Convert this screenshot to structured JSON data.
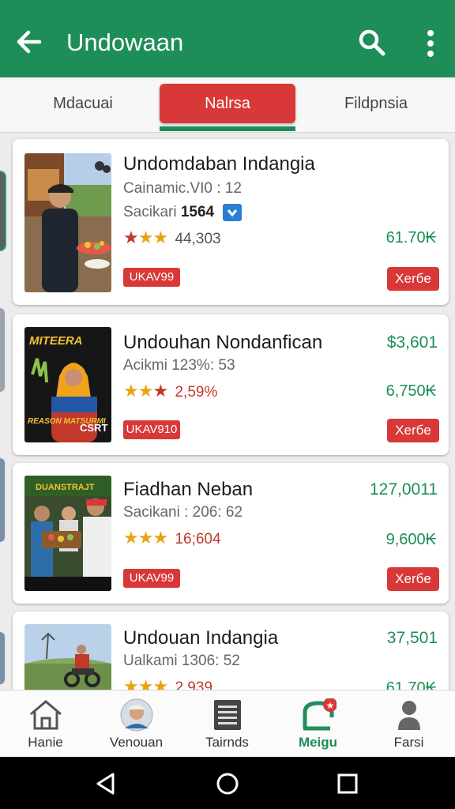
{
  "appbar": {
    "title": "Undowaan"
  },
  "tabs": [
    {
      "label": "Mdacuai"
    },
    {
      "label": "Nalrsa"
    },
    {
      "label": "Fildpnsia"
    }
  ],
  "cards": [
    {
      "name": "Undomdaban Indangia",
      "meta": "Cainamic.VI0 : 12",
      "meta2_label": "Sacikari",
      "meta2_value": "1564",
      "rating": "44,303",
      "price_top": "",
      "price": "61.70₭",
      "tag": "UKAV99",
      "button": "Xerбe"
    },
    {
      "name": "Undouhan Nondanfican",
      "meta": "Acikmi 123%: 53",
      "rating": "2,59%",
      "price_top": "$3,601",
      "price": "6,750₭",
      "tag": "UKAV910",
      "button": "Xerбe"
    },
    {
      "name": "Fiadhan Neban",
      "meta": "Sacikani : 206: 62",
      "rating": "16;604",
      "price_top": "127,0011",
      "price": "9,600₭",
      "tag": "UKAV99",
      "button": "Xerбe"
    },
    {
      "name": "Undouan Indangia",
      "meta": "Ualkami 1306: 52",
      "rating": "2,939",
      "price_top": "37,501",
      "price": "61.70₭"
    }
  ],
  "thumb_text": {
    "card2_top": "MITEERA",
    "card2_bottom": "REASON MATSURMI",
    "card2_side": "CSRT",
    "card3_banner": "DUANSTRAJT"
  },
  "bottom_nav": [
    {
      "label": "Hanie",
      "icon": "home-icon"
    },
    {
      "label": "Venouan",
      "icon": "avatar-icon"
    },
    {
      "label": "Tairnds",
      "icon": "list-icon"
    },
    {
      "label": "Meigu",
      "icon": "bag-icon"
    },
    {
      "label": "Farsi",
      "icon": "person-icon"
    }
  ],
  "colors": {
    "primary": "#1e8e58",
    "accent": "#d93838",
    "star": "#e8a315"
  }
}
